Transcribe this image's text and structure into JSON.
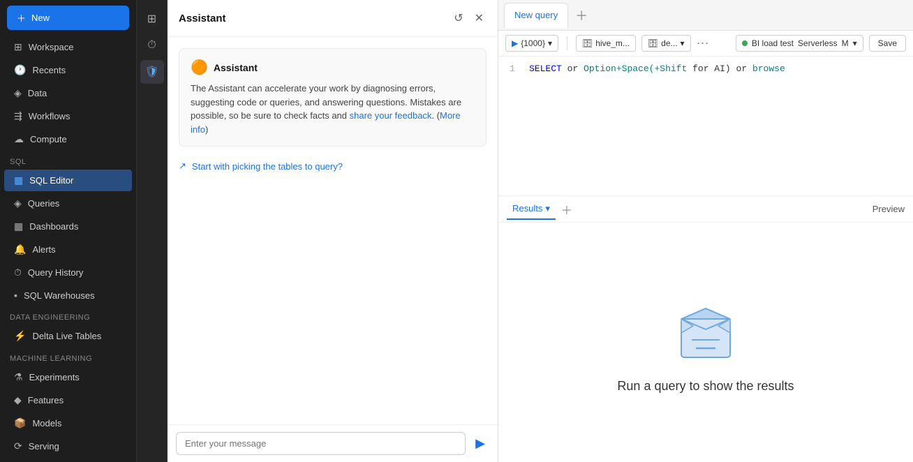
{
  "sidebar": {
    "new_label": "New",
    "items": [
      {
        "id": "workspace",
        "label": "Workspace",
        "icon": "⊞"
      },
      {
        "id": "recents",
        "label": "Recents",
        "icon": "🕐"
      },
      {
        "id": "data",
        "label": "Data",
        "icon": "◈"
      },
      {
        "id": "workflows",
        "label": "Workflows",
        "icon": "⇶"
      },
      {
        "id": "compute",
        "label": "Compute",
        "icon": "☁"
      }
    ],
    "sql_label": "SQL",
    "sql_items": [
      {
        "id": "sql-editor",
        "label": "SQL Editor",
        "icon": "▦",
        "active": true
      },
      {
        "id": "queries",
        "label": "Queries",
        "icon": "◈"
      },
      {
        "id": "dashboards",
        "label": "Dashboards",
        "icon": "▦"
      },
      {
        "id": "alerts",
        "label": "Alerts",
        "icon": "🔔"
      },
      {
        "id": "query-history",
        "label": "Query History",
        "icon": "⏱"
      },
      {
        "id": "sql-warehouses",
        "label": "SQL Warehouses",
        "icon": "▪"
      }
    ],
    "data_engineering_label": "Data Engineering",
    "de_items": [
      {
        "id": "delta-live-tables",
        "label": "Delta Live Tables",
        "icon": "⚡"
      }
    ],
    "ml_label": "Machine Learning",
    "ml_items": [
      {
        "id": "experiments",
        "label": "Experiments",
        "icon": "⚗"
      },
      {
        "id": "features",
        "label": "Features",
        "icon": "◆"
      },
      {
        "id": "models",
        "label": "Models",
        "icon": "📦"
      },
      {
        "id": "serving",
        "label": "Serving",
        "icon": "⟳"
      }
    ]
  },
  "icon_panel": {
    "buttons": [
      {
        "id": "grid",
        "icon": "⊞",
        "active": false
      },
      {
        "id": "history",
        "icon": "⏱",
        "active": false
      },
      {
        "id": "shield",
        "icon": "🛡",
        "active": true
      }
    ]
  },
  "assistant": {
    "title": "Assistant",
    "message": {
      "avatar": "🟠",
      "name": "Assistant",
      "text_before_link1": "The Assistant can accelerate your work by diagnosing errors, suggesting code or queries, and answering questions. Mistakes are possible, so be sure to check facts and ",
      "link1_text": "share your feedback",
      "text_before_link2": ". (",
      "link2_text": "More info",
      "text_after": ")"
    },
    "suggestion": "Start with picking the tables to query?",
    "input_placeholder": "Enter your message"
  },
  "tabs": {
    "items": [
      {
        "id": "new-query",
        "label": "New query",
        "active": true
      }
    ],
    "add_tooltip": "Add new tab"
  },
  "toolbar": {
    "run_label": "{1000}",
    "catalog_icon": "⊟",
    "catalog_label": "hive_m...",
    "schema_icon": "⊟",
    "schema_label": "de...",
    "more_icon": "⋯",
    "cluster_status": "BI load test",
    "cluster_type": "Serverless",
    "cluster_mode": "M",
    "save_label": "Save"
  },
  "editor": {
    "line_number": "1",
    "select_kw": "SELECT",
    "or1": "or",
    "option_hint": "Option+Space(+Shift",
    "for_kw": "for AI)",
    "or2": "or",
    "browse_kw": "browse"
  },
  "results": {
    "tabs": [
      {
        "id": "results",
        "label": "Results",
        "active": true
      }
    ],
    "preview_label": "Preview",
    "empty_state_text": "Run a query to show the results"
  }
}
